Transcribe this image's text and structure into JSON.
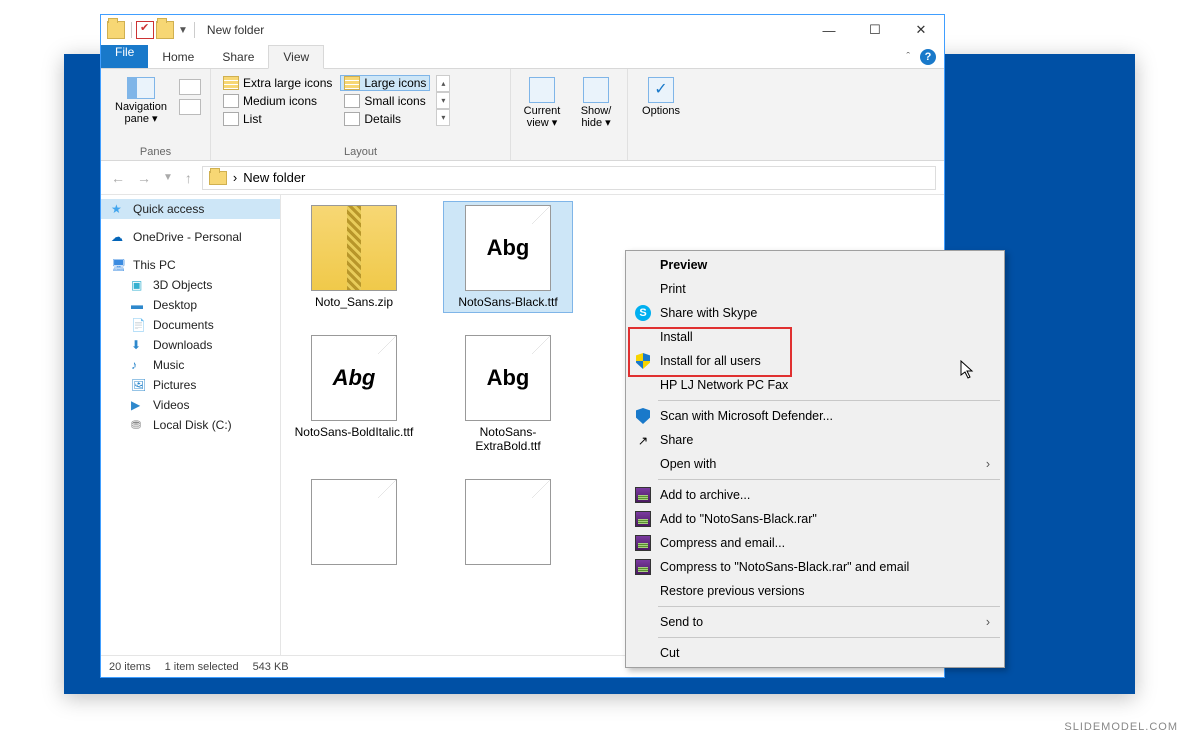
{
  "window": {
    "title": "New folder"
  },
  "menus": {
    "file": "File",
    "home": "Home",
    "share": "Share",
    "view": "View"
  },
  "ribbon": {
    "panes_label": "Panes",
    "layout_label": "Layout",
    "nav_pane": "Navigation pane ▾",
    "xl_icons": "Extra large icons",
    "lg_icons": "Large icons",
    "md_icons": "Medium icons",
    "sm_icons": "Small icons",
    "list": "List",
    "details": "Details",
    "current_view": "Current view ▾",
    "show_hide": "Show/ hide ▾",
    "options": "Options"
  },
  "breadcrumb": {
    "sep": "›",
    "folder": "New folder"
  },
  "sidebar": {
    "quick": "Quick access",
    "onedrive": "OneDrive - Personal",
    "thispc": "This PC",
    "s3d": "3D Objects",
    "desktop": "Desktop",
    "documents": "Documents",
    "downloads": "Downloads",
    "music": "Music",
    "pictures": "Pictures",
    "videos": "Videos",
    "localdisk": "Local Disk (C:)"
  },
  "files": [
    {
      "name": "Noto_Sans.zip",
      "type": "zip"
    },
    {
      "name": "NotoSans-Black.ttf",
      "type": "font",
      "selected": true
    },
    {
      "name": "NotoSans-BoldItalic.ttf",
      "type": "font-italic"
    },
    {
      "name": "NotoSans-ExtraBold.ttf",
      "type": "font"
    }
  ],
  "status": {
    "count": "20 items",
    "selection": "1 item selected",
    "size": "543 KB"
  },
  "context": {
    "preview": "Preview",
    "print": "Print",
    "skype": "Share with Skype",
    "install": "Install",
    "install_all": "Install for all users",
    "hp": "HP LJ Network PC Fax",
    "defender": "Scan with Microsoft Defender...",
    "share": "Share",
    "openwith": "Open with",
    "addarchive": "Add to archive...",
    "addrar": "Add to \"NotoSans-Black.rar\"",
    "compress": "Compress and email...",
    "compressrar": "Compress to \"NotoSans-Black.rar\" and email",
    "restore": "Restore previous versions",
    "sendto": "Send to",
    "cut": "Cut"
  },
  "watermark": "SLIDEMODEL.COM"
}
